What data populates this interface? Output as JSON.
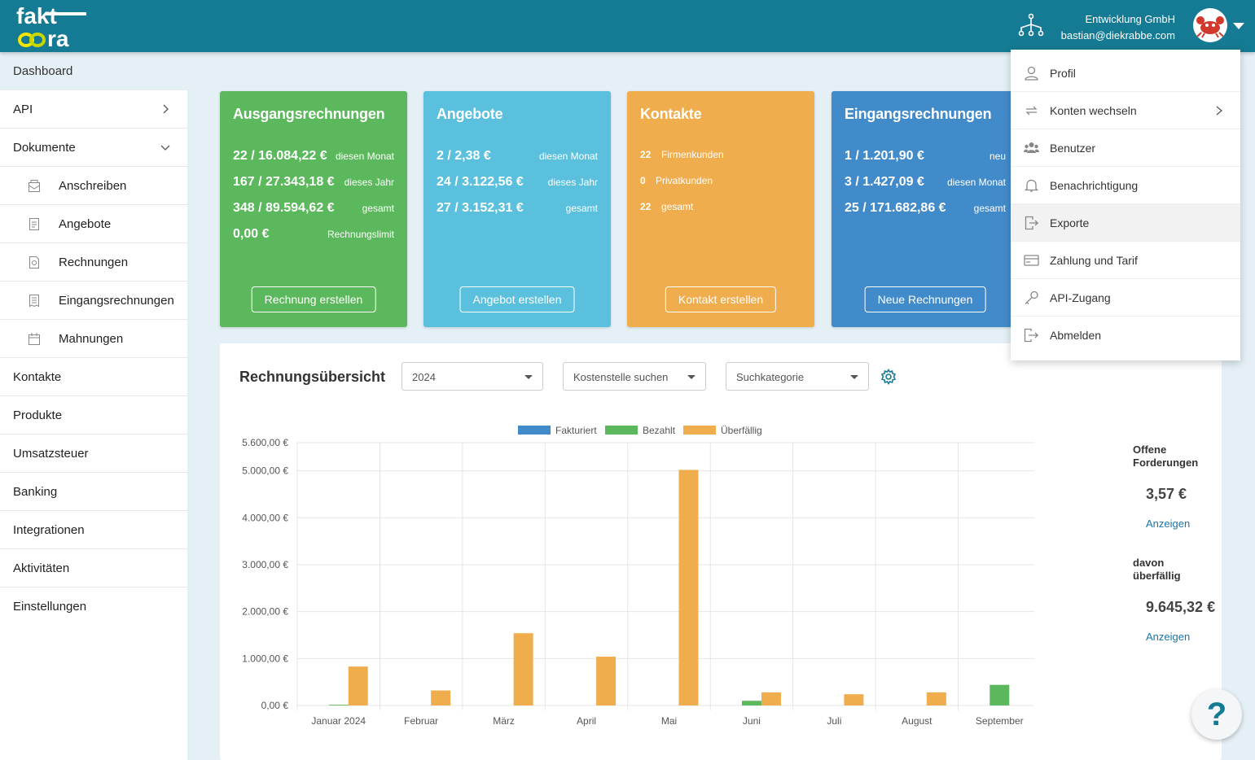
{
  "header": {
    "logo_top": "fakt",
    "logo_bottom": "ra",
    "company": "Entwicklung GmbH",
    "email": "bastian@diekrabbe.com"
  },
  "sidebar": {
    "dashboard": "Dashboard",
    "items": [
      {
        "label": "API"
      },
      {
        "label": "Dokumente"
      },
      {
        "label": "Anschreiben"
      },
      {
        "label": "Angebote"
      },
      {
        "label": "Rechnungen"
      },
      {
        "label": "Eingangsrechnungen"
      },
      {
        "label": "Mahnungen"
      },
      {
        "label": "Kontakte"
      },
      {
        "label": "Produkte"
      },
      {
        "label": "Umsatzsteuer"
      },
      {
        "label": "Banking"
      },
      {
        "label": "Integrationen"
      },
      {
        "label": "Aktivitäten"
      },
      {
        "label": "Einstellungen"
      }
    ]
  },
  "cards": {
    "ausgang": {
      "title": "Ausgangsrechnungen",
      "rows": [
        {
          "value": "22 / 16.084,22 €",
          "label": "diesen Monat"
        },
        {
          "value": "167 / 27.343,18 €",
          "label": "dieses Jahr"
        },
        {
          "value": "348 / 89.594,62 €",
          "label": "gesamt"
        },
        {
          "value": "0,00 €",
          "label": "Rechnungslimit"
        }
      ],
      "button": "Rechnung erstellen",
      "color": "#5cb85c"
    },
    "angebote": {
      "title": "Angebote",
      "rows": [
        {
          "value": "2 / 2,38 €",
          "label": "diesen Monat"
        },
        {
          "value": "24 / 3.122,56 €",
          "label": "dieses Jahr"
        },
        {
          "value": "27 / 3.152,31 €",
          "label": "gesamt"
        }
      ],
      "button": "Angebot erstellen",
      "color": "#5bc0de"
    },
    "kontakte": {
      "title": "Kontakte",
      "rows": [
        {
          "value": "22",
          "label": "Firmenkunden"
        },
        {
          "value": "0",
          "label": "Privatkunden"
        },
        {
          "value": "22",
          "label": "gesamt"
        }
      ],
      "button": "Kontakt erstellen",
      "color": "#f0ad4e"
    },
    "eingang": {
      "title": "Eingangsrechnungen",
      "rows": [
        {
          "value": "1 / 1.201,90 €",
          "label": "neu"
        },
        {
          "value": "3 / 1.427,09 €",
          "label": "diesen Monat"
        },
        {
          "value": "25 / 171.682,86 €",
          "label": "gesamt"
        }
      ],
      "button": "Neue Rechnungen",
      "color": "#428bca"
    }
  },
  "overview": {
    "title": "Rechnungsübersicht",
    "year_select": "2024",
    "cost_center_placeholder": "Kostenstelle suchen",
    "category_placeholder": "Suchkategorie",
    "open_label": "Offene Forderungen",
    "open_value": "3,57 €",
    "show_label": "Anzeigen",
    "overdue_label": "davon überfällig",
    "overdue_value": "9.645,32 €"
  },
  "chart_data": {
    "type": "bar",
    "categories": [
      "Januar 2024",
      "Februar",
      "März",
      "April",
      "Mai",
      "Juni",
      "Juli",
      "August",
      "September"
    ],
    "series": [
      {
        "name": "Fakturiert",
        "color": "#428bca",
        "values": [
          0,
          0,
          0,
          0,
          0,
          0,
          0,
          0,
          0
        ]
      },
      {
        "name": "Bezahlt",
        "color": "#5cb85c",
        "values": [
          15,
          0,
          0,
          0,
          0,
          100,
          0,
          0,
          440
        ]
      },
      {
        "name": "Überfällig",
        "color": "#f0ad4e",
        "values": [
          830,
          320,
          1540,
          1040,
          5020,
          280,
          240,
          280,
          0
        ]
      }
    ],
    "ylim": [
      0,
      5600
    ],
    "yticks": [
      {
        "value": 0,
        "label": "0,00 €"
      },
      {
        "value": 1000,
        "label": "1.000,00 €"
      },
      {
        "value": 2000,
        "label": "2.000,00 €"
      },
      {
        "value": 3000,
        "label": "3.000,00 €"
      },
      {
        "value": 4000,
        "label": "4.000,00 €"
      },
      {
        "value": 5000,
        "label": "5.000,00 €"
      },
      {
        "value": 5600,
        "label": "5.600,00 €"
      }
    ],
    "legend": "top-center",
    "grid": true
  },
  "menu": {
    "items": [
      {
        "label": "Profil",
        "icon": "user-icon"
      },
      {
        "label": "Konten wechseln",
        "icon": "switch-icon"
      },
      {
        "label": "Benutzer",
        "icon": "users-icon"
      },
      {
        "label": "Benachrichtigung",
        "icon": "bell-icon"
      },
      {
        "label": "Exporte",
        "icon": "export-icon"
      },
      {
        "label": "Zahlung und Tarif",
        "icon": "credit-card-icon"
      },
      {
        "label": "API-Zugang",
        "icon": "key-icon"
      },
      {
        "label": "Abmelden",
        "icon": "logout-icon"
      }
    ]
  },
  "help": "?"
}
